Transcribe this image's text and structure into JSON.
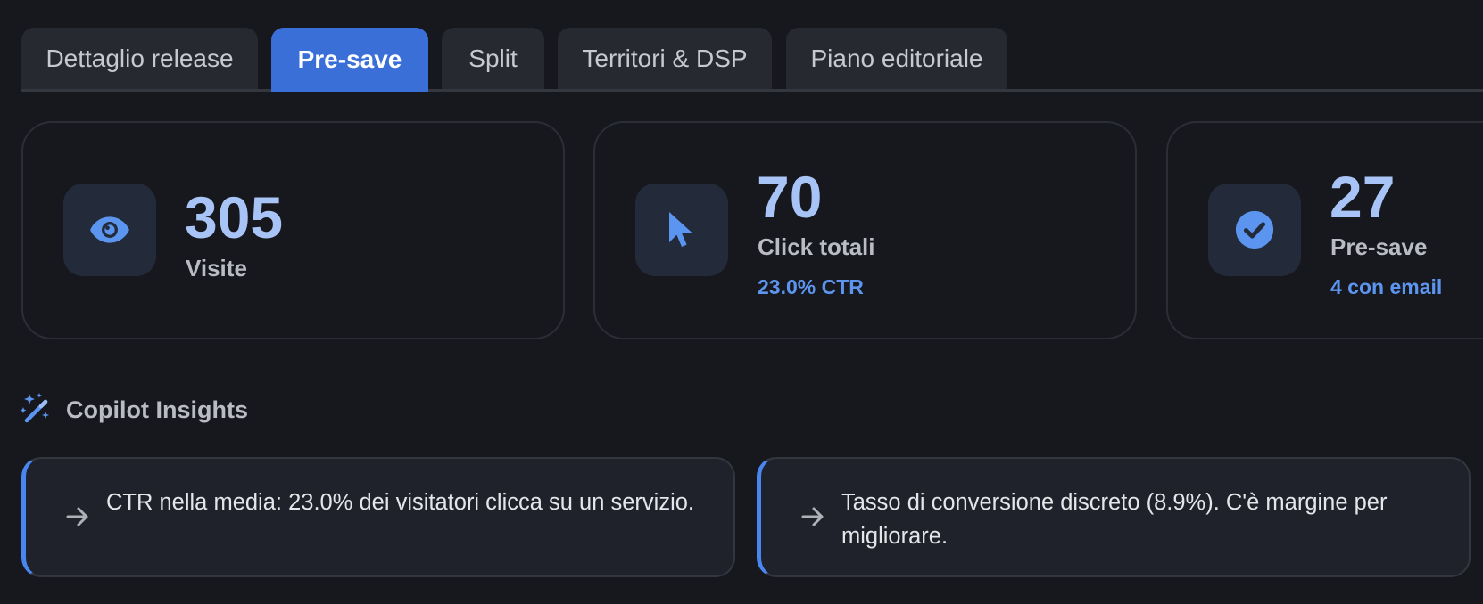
{
  "tabs": [
    {
      "label": "Dettaglio release",
      "active": false
    },
    {
      "label": "Pre-save",
      "active": true
    },
    {
      "label": "Split",
      "active": false
    },
    {
      "label": "Territori & DSP",
      "active": false
    },
    {
      "label": "Piano editoriale",
      "active": false
    }
  ],
  "stats": [
    {
      "value": "305",
      "label": "Visite",
      "sub": "",
      "icon": "eye-icon"
    },
    {
      "value": "70",
      "label": "Click totali",
      "sub": "23.0% CTR",
      "icon": "cursor-icon"
    },
    {
      "value": "27",
      "label": "Pre-save",
      "sub": "4 con email",
      "icon": "check-circle-icon"
    }
  ],
  "insights_section": {
    "title": "Copilot Insights",
    "icon": "magic-wand-icon"
  },
  "insights": [
    {
      "text": "CTR nella media: 23.0% dei visitatori clicca su un servizio.",
      "icon": "arrow-right-icon"
    },
    {
      "text": "Tasso di conversione discreto (8.9%). C'è margine per migliorare.",
      "icon": "arrow-right-icon"
    }
  ],
  "colors": {
    "background": "#16181e",
    "accent": "#3a6fd8",
    "stat_value": "#a8c4f7",
    "sub_text": "#5d95ee",
    "icon_blue": "#5b95f0"
  }
}
